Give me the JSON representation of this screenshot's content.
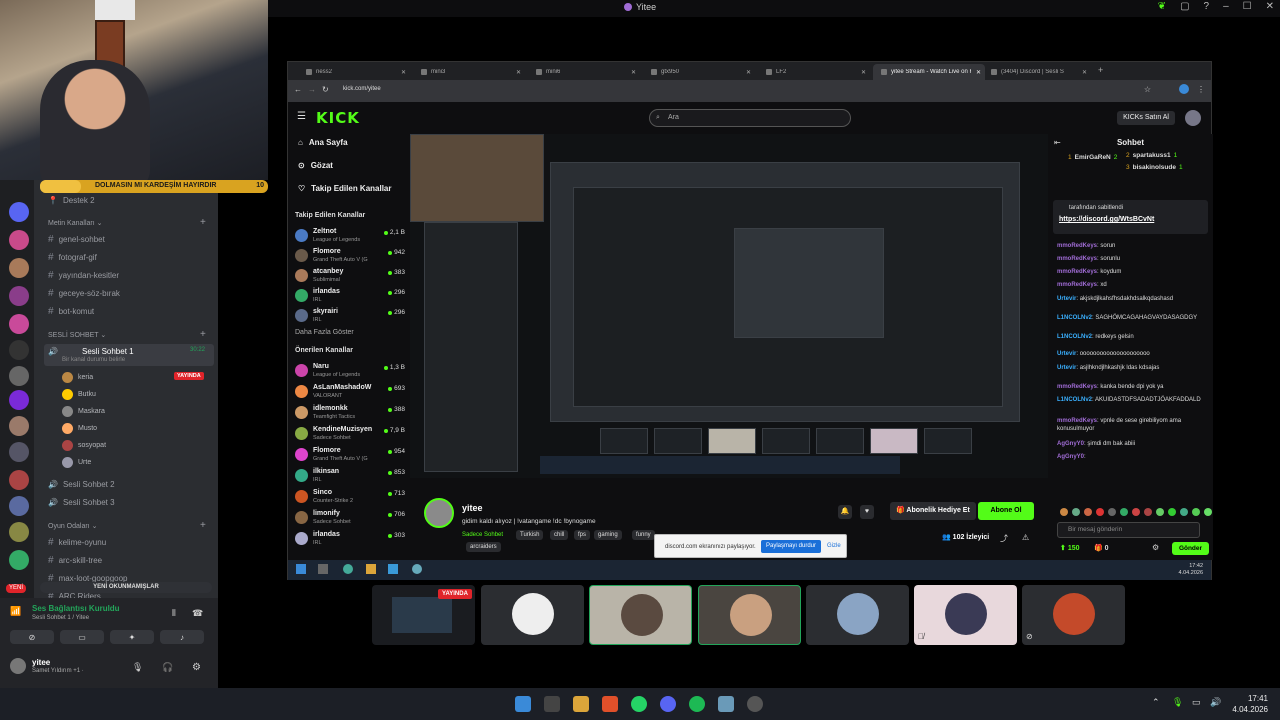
{
  "window": {
    "title": "Yitee"
  },
  "raid": {
    "text": "DOLMASIN MI KARDEŞİM HAYIRDIR",
    "count": "10",
    "progress": 0.18
  },
  "discord": {
    "top_item": "Destek 2",
    "text_category": "Metin Kanalları",
    "text_channels": [
      "genel-sohbet",
      "fotograf-gif",
      "yayından-kesitler",
      "geceye-söz-bırak",
      "bot-komut"
    ],
    "voice_category": "SESLİ SOHBET",
    "active_voice": {
      "name": "Sesli Sohbet 1",
      "time": "30:22",
      "status": "Bir kanal durumu belirle"
    },
    "voice_users": [
      {
        "name": "keria",
        "badge": "YAYINDA"
      },
      {
        "name": "Butku",
        "badge": ""
      },
      {
        "name": "Maskara",
        "badge": ""
      },
      {
        "name": "Musto",
        "badge": ""
      },
      {
        "name": "sosyopat",
        "badge": ""
      },
      {
        "name": "Urte",
        "badge": ""
      }
    ],
    "other_voice": [
      "Sesli Sohbet 2",
      "Sesli Sohbet 3"
    ],
    "game_category": "Oyun Odaları",
    "game_channels": [
      "kelime-oyunu",
      "arc-skill-tree",
      "max-loot-goopgoop",
      "ARC Riders"
    ],
    "unread_pill": "YENİ OKUNMAMIŞLAR",
    "new_badge": "YENİ",
    "connection": {
      "title": "Ses Bağlantısı Kuruldu",
      "sub": "Sesli Sohbet 1 / Yitee"
    },
    "user": {
      "name": "yitee",
      "status": "Samet Yıldırım +1 ·"
    }
  },
  "browser": {
    "tabs": [
      "ness2",
      "mini3",
      "mini6",
      "gtx950",
      "LF2",
      "yitee Stream - Watch Live on K",
      "(3404) Discord | Sesli S"
    ],
    "url": "kick.com/yitee"
  },
  "kick": {
    "logo": "KICK",
    "search_placeholder": "Ara",
    "buy_kicks": "KICKs Satın Al",
    "nav": [
      "Ana Sayfa",
      "Gözat",
      "Takip Edilen Kanallar"
    ],
    "followed_title": "Takip Edilen Kanallar",
    "followed": [
      {
        "name": "Zeltnot",
        "game": "League of Legends",
        "viewers": "2,1 B"
      },
      {
        "name": "Flomore",
        "game": "Grand Theft Auto V (G...",
        "viewers": "942"
      },
      {
        "name": "atcanbey",
        "game": "Sublimimal",
        "viewers": "383"
      },
      {
        "name": "irlandas",
        "game": "IRL",
        "viewers": "296"
      },
      {
        "name": "skyrairi",
        "game": "IRL",
        "viewers": "296"
      }
    ],
    "show_more": "Daha Fazla Göster",
    "recommended_title": "Önerilen Kanallar",
    "recommended": [
      {
        "name": "Naru",
        "game": "League of Legends",
        "viewers": "1,3 B"
      },
      {
        "name": "AsLanMashadoW",
        "game": "VALORANT",
        "viewers": "693"
      },
      {
        "name": "idlemonkk",
        "game": "Teamfight Tactics",
        "viewers": "388"
      },
      {
        "name": "KendineMuzisyen",
        "game": "Sadece Sohbet",
        "viewers": "7,9 B"
      },
      {
        "name": "Flomore",
        "game": "Grand Theft Auto V (G...",
        "viewers": "954"
      },
      {
        "name": "ilkinsan",
        "game": "IRL",
        "viewers": "853"
      },
      {
        "name": "Sinco",
        "game": "Counter-Strike 2",
        "viewers": "713"
      },
      {
        "name": "limonify",
        "game": "Sadece Sohbet",
        "viewers": "706"
      },
      {
        "name": "irlandas",
        "game": "IRL",
        "viewers": "303"
      }
    ],
    "streamer": "yitee",
    "stream_title": "gidim kaldı alıyoz | !vatangame !dc !bynogame",
    "tags": [
      "Sadece Sohbet",
      "Turkish",
      "chill",
      "fps",
      "gaming",
      "funny",
      "arcraiders"
    ],
    "sub_gift": "Abonelik Hediye Et",
    "follow": "Abone Ol",
    "viewers": "102 İzleyici",
    "chat_title": "Sohbet",
    "leaderboard": [
      {
        "rank": "1",
        "name": "EmirGaReN",
        "count": "2"
      },
      {
        "rank": "2",
        "name": "spartakuss1",
        "count": "1"
      },
      {
        "rank": "3",
        "name": "bisakinolsude",
        "count": "1"
      }
    ],
    "pinned_by": "tarafından sabitlendi",
    "pinned_link": "https://discord.gg/WtsBCvNt",
    "messages": [
      {
        "user": "mmoRedKeys",
        "text": "sorun",
        "color": "#a06cd5"
      },
      {
        "user": "mmoRedKeys",
        "text": "sorunlu",
        "color": "#a06cd5"
      },
      {
        "user": "mmoRedKeys",
        "text": "koydum",
        "color": "#a06cd5"
      },
      {
        "user": "mmoRedKeys",
        "text": "xd",
        "color": "#a06cd5"
      },
      {
        "user": "Urtevir",
        "text": "akjskdjlkahsfhsdakhdsalkqdashasd",
        "color": "#3ab0ff"
      },
      {
        "user": "L1NCOLNv2",
        "text": "SAGHÖMCAGAHAGVAYDASAGDGY",
        "color": "#3ab0ff"
      },
      {
        "user": "L1NCOLNv2",
        "text": "redkeys gelsin",
        "color": "#3ab0ff"
      },
      {
        "user": "Urtevir",
        "text": "ooooooooooooooooooooo",
        "color": "#3ab0ff"
      },
      {
        "user": "Urtevir",
        "text": "asjlhkndjlhkashjk ldas kdsajas",
        "color": "#3ab0ff"
      },
      {
        "user": "mmoRedKeys",
        "text": "kanka bende dpi yok ya",
        "color": "#a06cd5"
      },
      {
        "user": "L1NCOLNv2",
        "text": "AKUIDASTDFSADADTJÖAKFADDALD",
        "color": "#3ab0ff"
      },
      {
        "user": "mmoRedKeys",
        "text": "vpnle de sese girebiliyom ama konusulmuyor",
        "color": "#a06cd5"
      },
      {
        "user": "AgGnyY0",
        "text": "şimdi dm bak abiii",
        "color": "#a06cd5"
      },
      {
        "user": "AgGnyY0",
        "text": "",
        "color": "#a06cd5"
      }
    ],
    "chat_placeholder": "Bir mesaj gönderin",
    "points": "150",
    "gifts": "0",
    "send": "Gönder"
  },
  "share_bar": {
    "message": "discord.com ekranınızı paylaşıyor.",
    "stop": "Paylaşmayı durdur",
    "hide": "Gizle"
  },
  "inner_clock": {
    "time": "17:42",
    "date": "4.04.2026"
  },
  "live_badge": "YAYINDA",
  "clock": {
    "time": "17:41",
    "date": "4.04.2026"
  }
}
